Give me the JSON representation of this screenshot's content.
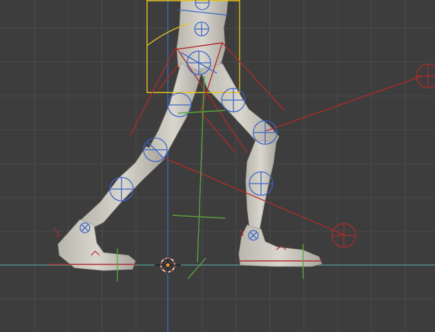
{
  "viewport": {
    "mode": "3d-viewport-pose",
    "colors": {
      "background": "#3d3d3d",
      "grid": "#4a4a4a",
      "axis_x": "#5aa09b",
      "axis_z": "#3f68a8",
      "mesh": "#cfccc3",
      "bone_ik": "#b02a2a",
      "bone_fk": "#3b63c8",
      "bone_root": "#56a83c",
      "selection": "#e8c320",
      "origin": "#f1a23b"
    },
    "icons": [
      "3d-cursor-icon",
      "ik-target-icon",
      "pole-target-icon"
    ]
  }
}
